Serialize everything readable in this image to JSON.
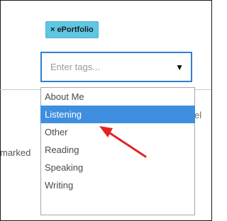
{
  "tag": {
    "remove_symbol": "×",
    "label": "ePortfolio"
  },
  "input": {
    "placeholder": "Enter tags...",
    "caret": "▼"
  },
  "background": {
    "right_fragment": "el",
    "left_fragment": "marked"
  },
  "dropdown": {
    "items": [
      "About Me",
      "Listening",
      "Other",
      "Reading",
      "Speaking",
      "Writing"
    ],
    "selected": "Listening"
  },
  "colors": {
    "chip": "#5fc7e3",
    "focus_border": "#2f80d1",
    "selected_bg": "#3f8fe0",
    "arrow": "#e32424"
  },
  "icons": {
    "remove": "close-icon",
    "caret": "chevron-down-icon",
    "annotation": "red-arrow-icon"
  }
}
